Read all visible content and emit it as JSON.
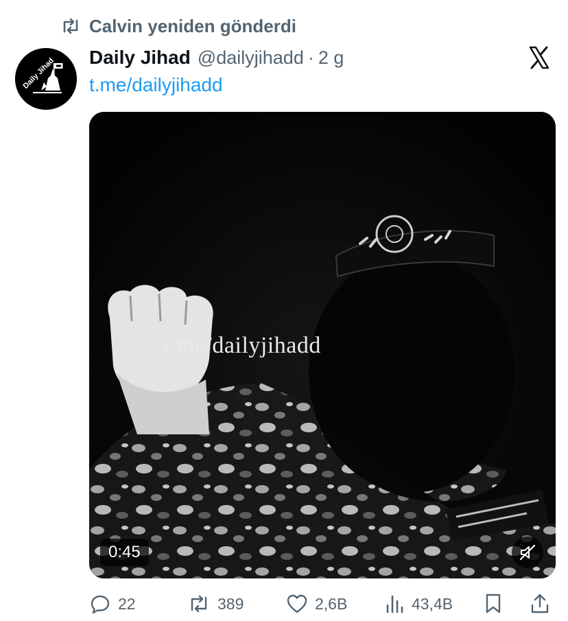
{
  "social_context": {
    "text": "Calvin yeniden gönderdi",
    "icon": "retweet-icon"
  },
  "author": {
    "name": "Daily Jihad",
    "handle": "@dailyjihadd",
    "separator": "·",
    "time": "2 g",
    "avatar_text": "Daily Jihad"
  },
  "platform_logo": "x-logo-icon",
  "post": {
    "link_text": "t.me/dailyjihadd"
  },
  "video": {
    "watermark": "t.me/dailyjihadd",
    "duration": "0:45",
    "muted": true
  },
  "actions": {
    "replies": "22",
    "reposts": "389",
    "likes": "2,6B",
    "views": "43,4B"
  },
  "colors": {
    "accent": "#1d9bf0",
    "muted_text": "#536471",
    "text": "#0f1419"
  }
}
